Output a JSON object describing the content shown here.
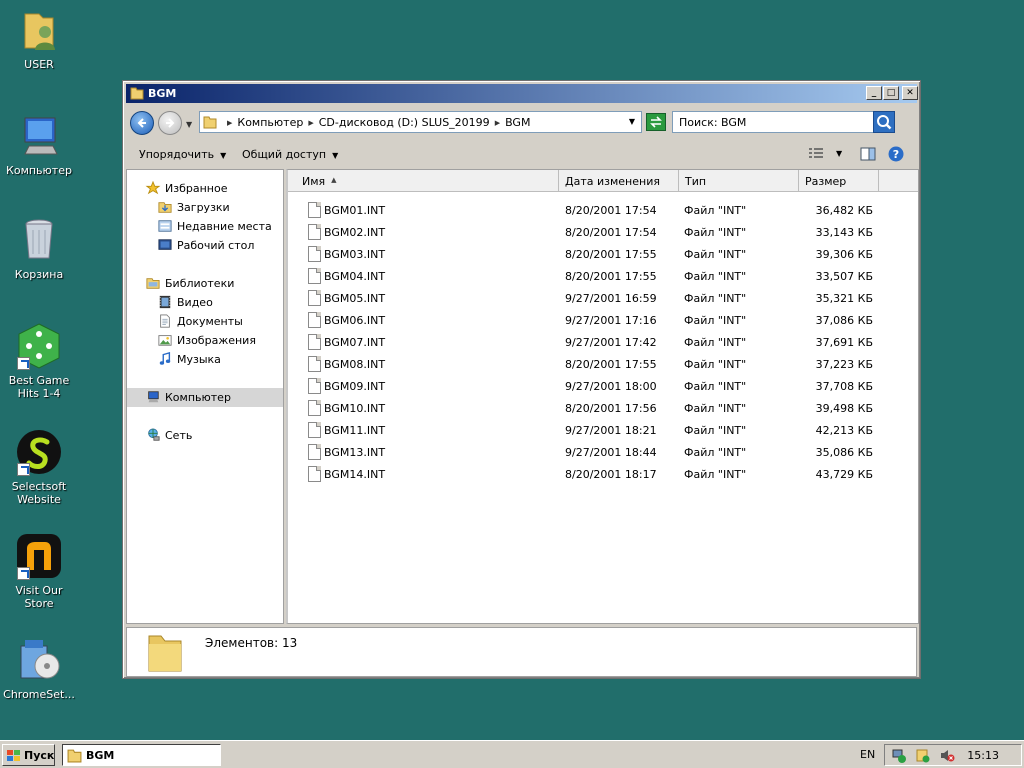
{
  "desktop": {
    "icons": [
      {
        "label": "USER"
      },
      {
        "label": "Компьютер"
      },
      {
        "label": "Корзина"
      },
      {
        "label": "Best Game Hits 1-4"
      },
      {
        "label": "Selectsoft Website"
      },
      {
        "label": "Visit Our Store"
      },
      {
        "label": "ChromeSet..."
      }
    ]
  },
  "window": {
    "title": "BGM",
    "breadcrumb": [
      "Компьютер",
      "CD-дисковод (D:) SLUS_20199",
      "BGM"
    ],
    "search_placeholder": "Поиск: BGM",
    "commands": {
      "organize": "Упорядочить",
      "share": "Общий доступ"
    },
    "nav": {
      "favorites": "Избранное",
      "favorites_items": [
        "Загрузки",
        "Недавние места",
        "Рабочий стол"
      ],
      "libraries": "Библиотеки",
      "libraries_items": [
        "Видео",
        "Документы",
        "Изображения",
        "Музыка"
      ],
      "computer": "Компьютер",
      "network": "Сеть"
    },
    "columns": {
      "name": "Имя",
      "date": "Дата изменения",
      "type": "Тип",
      "size": "Размер"
    },
    "files": [
      {
        "name": "BGM01.INT",
        "date": "8/20/2001 17:54",
        "type": "Файл \"INT\"",
        "size": "36,482 КБ"
      },
      {
        "name": "BGM02.INT",
        "date": "8/20/2001 17:54",
        "type": "Файл \"INT\"",
        "size": "33,143 КБ"
      },
      {
        "name": "BGM03.INT",
        "date": "8/20/2001 17:55",
        "type": "Файл \"INT\"",
        "size": "39,306 КБ"
      },
      {
        "name": "BGM04.INT",
        "date": "8/20/2001 17:55",
        "type": "Файл \"INT\"",
        "size": "33,507 КБ"
      },
      {
        "name": "BGM05.INT",
        "date": "9/27/2001 16:59",
        "type": "Файл \"INT\"",
        "size": "35,321 КБ"
      },
      {
        "name": "BGM06.INT",
        "date": "9/27/2001 17:16",
        "type": "Файл \"INT\"",
        "size": "37,086 КБ"
      },
      {
        "name": "BGM07.INT",
        "date": "9/27/2001 17:42",
        "type": "Файл \"INT\"",
        "size": "37,691 КБ"
      },
      {
        "name": "BGM08.INT",
        "date": "8/20/2001 17:55",
        "type": "Файл \"INT\"",
        "size": "37,223 КБ"
      },
      {
        "name": "BGM09.INT",
        "date": "9/27/2001 18:00",
        "type": "Файл \"INT\"",
        "size": "37,708 КБ"
      },
      {
        "name": "BGM10.INT",
        "date": "8/20/2001 17:56",
        "type": "Файл \"INT\"",
        "size": "39,498 КБ"
      },
      {
        "name": "BGM11.INT",
        "date": "9/27/2001 18:21",
        "type": "Файл \"INT\"",
        "size": "42,213 КБ"
      },
      {
        "name": "BGM13.INT",
        "date": "9/27/2001 18:44",
        "type": "Файл \"INT\"",
        "size": "35,086 КБ"
      },
      {
        "name": "BGM14.INT",
        "date": "8/20/2001 18:17",
        "type": "Файл \"INT\"",
        "size": "43,729 КБ"
      }
    ],
    "status": "Элементов: 13"
  },
  "taskbar": {
    "start": "Пуск",
    "task_title": "BGM",
    "language": "EN",
    "clock": "15:13"
  },
  "colors": {
    "desktop": "#216e6b",
    "title_active": "#0a246a",
    "chrome": "#d4d0c8"
  }
}
